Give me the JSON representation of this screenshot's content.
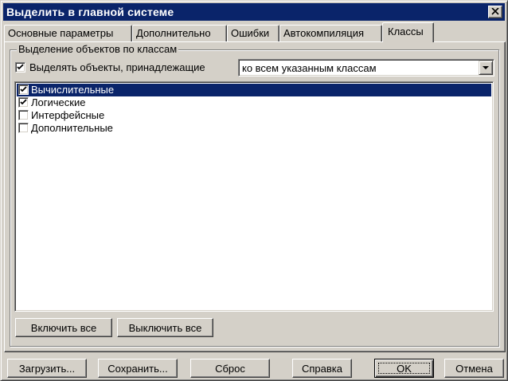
{
  "window": {
    "title": "Выделить в главной системе"
  },
  "tabs": [
    {
      "label": "Основные параметры",
      "active": false
    },
    {
      "label": "Дополнительно",
      "active": false
    },
    {
      "label": "Ошибки",
      "active": false
    },
    {
      "label": "Автокомпиляция",
      "active": false
    },
    {
      "label": "Классы",
      "active": true
    }
  ],
  "group": {
    "legend": "Выделение объектов по классам",
    "select_checkbox": {
      "label": "Выделять объекты, принадлежащие",
      "checked": true
    },
    "mode_combo": {
      "value": "ко всем указанным классам"
    },
    "classes": [
      {
        "label": "Вычислительные",
        "checked": true,
        "selected": true
      },
      {
        "label": "Логические",
        "checked": true,
        "selected": false
      },
      {
        "label": "Интерфейсные",
        "checked": false,
        "selected": false
      },
      {
        "label": "Дополнительные",
        "checked": false,
        "selected": false
      }
    ],
    "enable_all_label": "Включить все",
    "disable_all_label": "Выключить все"
  },
  "footer": {
    "load_label": "Загрузить...",
    "save_label": "Сохранить...",
    "reset_label": "Сброс",
    "help_label": "Справка",
    "ok_label": "OK",
    "cancel_label": "Отмена"
  },
  "colors": {
    "title_bar": "#0a246a",
    "face": "#d4d0c8",
    "selection": "#0a246a"
  }
}
